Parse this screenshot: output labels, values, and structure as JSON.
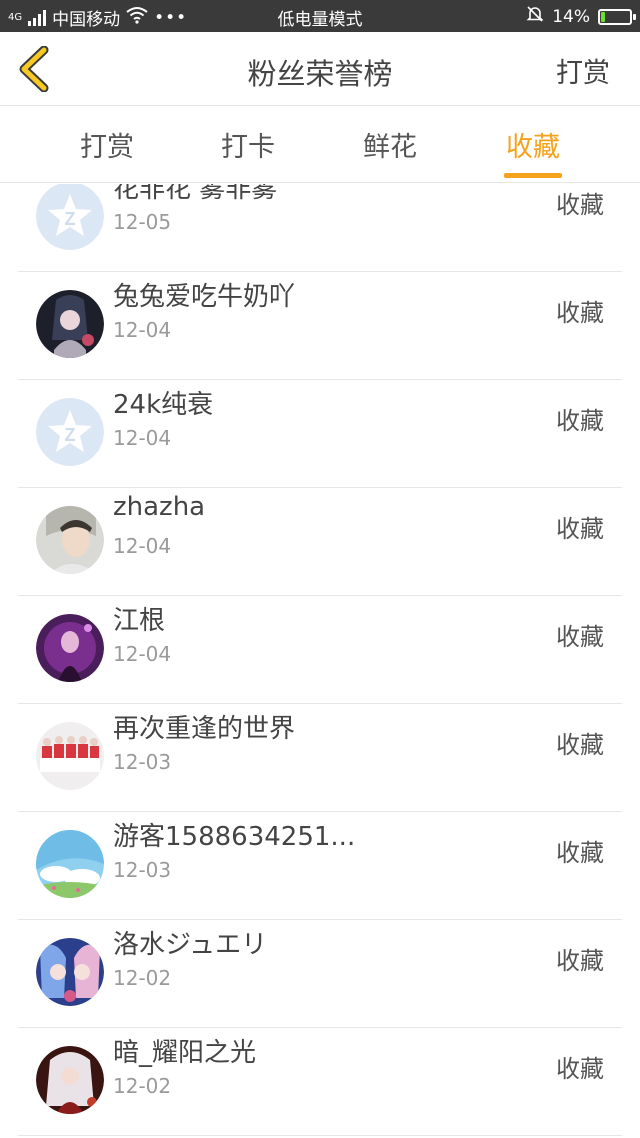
{
  "status_bar": {
    "network": "4G",
    "carrier": "中国移动",
    "mode": "低电量模式",
    "battery": "14%",
    "battery_level": 0.14,
    "icons": [
      "signal-icon",
      "wifi-icon",
      "more-dots-icon",
      "bell-muted-icon",
      "battery-icon"
    ]
  },
  "nav": {
    "back_icon": "chevron-left-icon",
    "title": "粉丝荣誉榜",
    "right": "打赏"
  },
  "tabs": [
    {
      "label": "打赏",
      "active": false
    },
    {
      "label": "打卡",
      "active": false
    },
    {
      "label": "鲜花",
      "active": false
    },
    {
      "label": "收藏",
      "active": true
    }
  ],
  "accent_color": "#f5a21d",
  "list": [
    {
      "name": "花非花 雾非雾",
      "date": "12-05",
      "action": "收藏",
      "avatar": "default"
    },
    {
      "name": "兔兔爱吃牛奶吖",
      "date": "12-04",
      "action": "收藏",
      "avatar": "dark-anime"
    },
    {
      "name": "24k纯衰",
      "date": "12-04",
      "action": "收藏",
      "avatar": "default"
    },
    {
      "name": "zhazha",
      "date": "12-04",
      "action": "收藏",
      "avatar": "person-light"
    },
    {
      "name": "江根",
      "date": "12-04",
      "action": "收藏",
      "avatar": "purple"
    },
    {
      "name": "再次重逢的世界",
      "date": "12-03",
      "action": "收藏",
      "avatar": "group-red"
    },
    {
      "name": "游客1588634251...",
      "date": "12-03",
      "action": "收藏",
      "avatar": "sky"
    },
    {
      "name": "洛水ジュエリ",
      "date": "12-02",
      "action": "收藏",
      "avatar": "anime-blue"
    },
    {
      "name": "暗_耀阳之光",
      "date": "12-02",
      "action": "收藏",
      "avatar": "dark-red"
    }
  ]
}
